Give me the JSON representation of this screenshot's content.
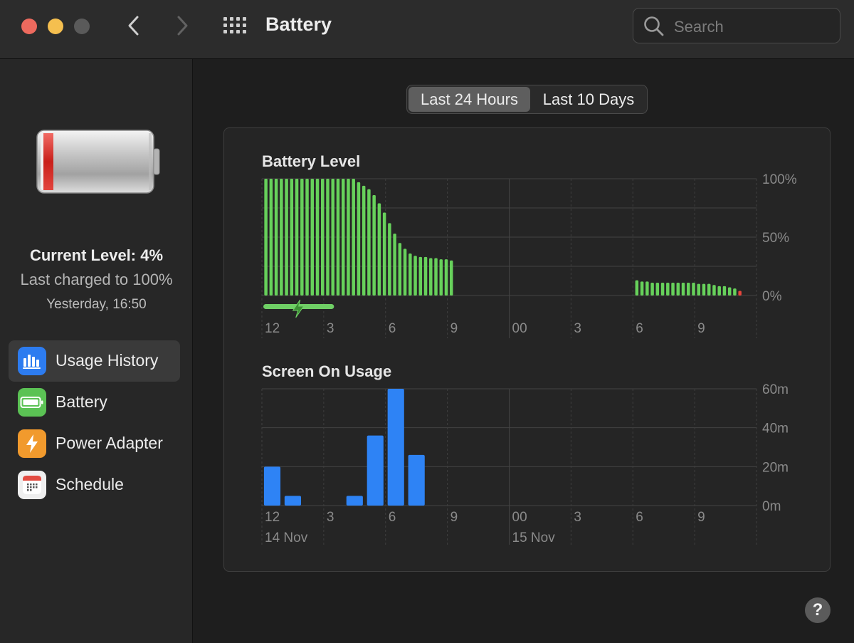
{
  "window": {
    "title": "Battery",
    "search_placeholder": "Search"
  },
  "sidebar": {
    "current_level": "Current Level: 4%",
    "last_charged": "Last charged to 100%",
    "last_charged_time": "Yesterday, 16:50",
    "items": [
      {
        "label": "Usage History",
        "icon": "bar-chart-icon",
        "selected": true
      },
      {
        "label": "Battery",
        "icon": "battery-icon",
        "selected": false
      },
      {
        "label": "Power Adapter",
        "icon": "lightning-bolt-icon",
        "selected": false
      },
      {
        "label": "Schedule",
        "icon": "calendar-icon",
        "selected": false
      }
    ]
  },
  "tabs": [
    {
      "label": "Last 24 Hours",
      "selected": true
    },
    {
      "label": "Last 10 Days",
      "selected": false
    }
  ],
  "colors": {
    "battery_bar": "#67d15b",
    "battery_low": "#e8453c",
    "screen_bar": "#2e83f5",
    "charging_indicator": "#6fcf65"
  },
  "chart_data": [
    {
      "type": "bar",
      "title": "Battery Level",
      "x_tick_labels": [
        "12",
        "3",
        "6",
        "9",
        "00",
        "3",
        "6",
        "9"
      ],
      "y_tick_labels": [
        "100%",
        "50%",
        "0%"
      ],
      "ylim": [
        0,
        100
      ],
      "grid": true,
      "charging_period_hours": [
        0,
        3.5
      ],
      "series": [
        {
          "start_hour": 0,
          "step_hours": 0.25,
          "values": [
            100,
            100,
            100,
            100,
            100,
            100,
            100,
            100,
            100,
            100,
            100,
            100,
            100,
            100,
            100,
            100,
            100,
            100,
            97,
            94,
            91,
            86,
            79,
            71,
            62,
            53,
            45,
            40,
            36,
            34,
            33,
            33,
            32,
            32,
            31,
            31,
            30
          ]
        },
        {
          "start_hour": 18,
          "step_hours": 0.25,
          "values": [
            13,
            12,
            12,
            11,
            11,
            11,
            11,
            11,
            11,
            11,
            11,
            11,
            10,
            10,
            10,
            9,
            8,
            8,
            7,
            6,
            4
          ]
        }
      ],
      "low_level_highlight_last": true
    },
    {
      "type": "bar",
      "title": "Screen On Usage",
      "x_tick_labels": [
        "12",
        "3",
        "6",
        "9",
        "00",
        "3",
        "6",
        "9"
      ],
      "date_labels": [
        "14 Nov",
        "15 Nov"
      ],
      "y_tick_labels": [
        "60m",
        "40m",
        "20m",
        "0m"
      ],
      "ylim": [
        0,
        60
      ],
      "grid": true,
      "series": [
        {
          "name": "",
          "values": [
            20,
            5,
            0,
            0,
            5,
            36,
            60,
            26,
            0,
            0,
            0,
            0,
            0,
            0,
            0,
            0,
            0,
            0,
            0,
            0,
            0,
            0,
            0,
            0
          ]
        }
      ]
    }
  ]
}
